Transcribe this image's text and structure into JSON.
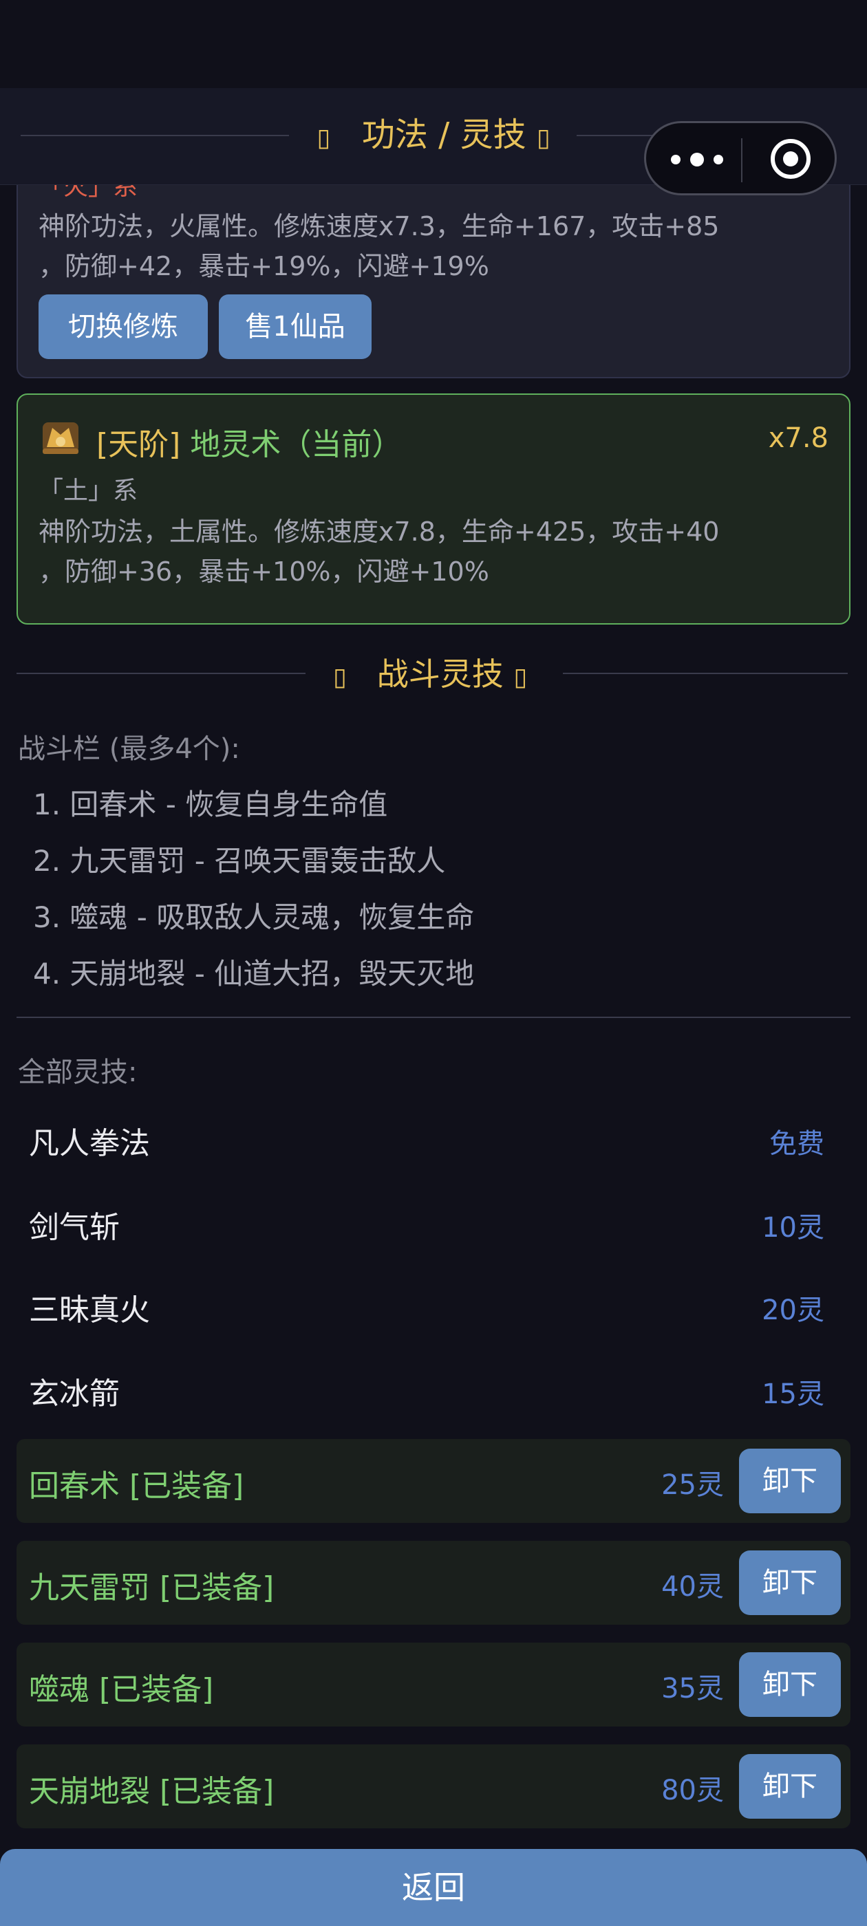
{
  "header": {
    "title": "功法 / 灵技",
    "left_glyph": "▯",
    "right_glyph": "▯"
  },
  "card_prev": {
    "type_label": "「火」系",
    "desc_line1": "神阶功法，火属性。修炼速度x7.3，生命+167，攻击+85",
    "desc_line2": "，防御+42，暴击+19%，闪避+19%",
    "switch_label": "切换修炼",
    "sell_label": "售1仙品"
  },
  "card_current": {
    "tier": "[天阶]",
    "name": "地灵术（当前）",
    "speed": "x7.8",
    "type_label": "「土」系",
    "desc_line1": "神阶功法，土属性。修炼速度x7.8，生命+425，攻击+40",
    "desc_line2": "，防御+36，暴击+10%，闪避+10%"
  },
  "battle": {
    "title": "战斗灵技",
    "left_glyph": "▯",
    "right_glyph": "▯",
    "bar_label": "战斗栏 (最多4个):",
    "slots": [
      "1. 回春术 - 恢复自身生命值",
      "2. 九天雷罚 - 召唤天雷轰击敌人",
      "3. 噬魂 - 吸取敌人灵魂，恢复生命",
      "4. 天崩地裂 - 仙道大招，毁天灭地"
    ]
  },
  "all_skills": {
    "label": "全部灵技:",
    "items": [
      {
        "name": "凡人拳法",
        "cost": "免费"
      },
      {
        "name": "剑气斩",
        "cost": "10灵"
      },
      {
        "name": "三昧真火",
        "cost": "20灵"
      },
      {
        "name": "玄冰箭",
        "cost": "15灵"
      }
    ],
    "equipped": [
      {
        "name": "回春术 [已装备]",
        "cost": "25灵",
        "action": "卸下"
      },
      {
        "name": "九天雷罚 [已装备]",
        "cost": "40灵",
        "action": "卸下"
      },
      {
        "name": "噬魂 [已装备]",
        "cost": "35灵",
        "action": "卸下"
      },
      {
        "name": "天崩地裂 [已装备]",
        "cost": "80灵",
        "action": "卸下"
      }
    ]
  },
  "back_label": "返回",
  "colors": {
    "accent_gold": "#e8c25a",
    "equipped_green": "#7fcf72",
    "button_blue": "#5b86bd",
    "cost_blue": "#5a82d6"
  }
}
